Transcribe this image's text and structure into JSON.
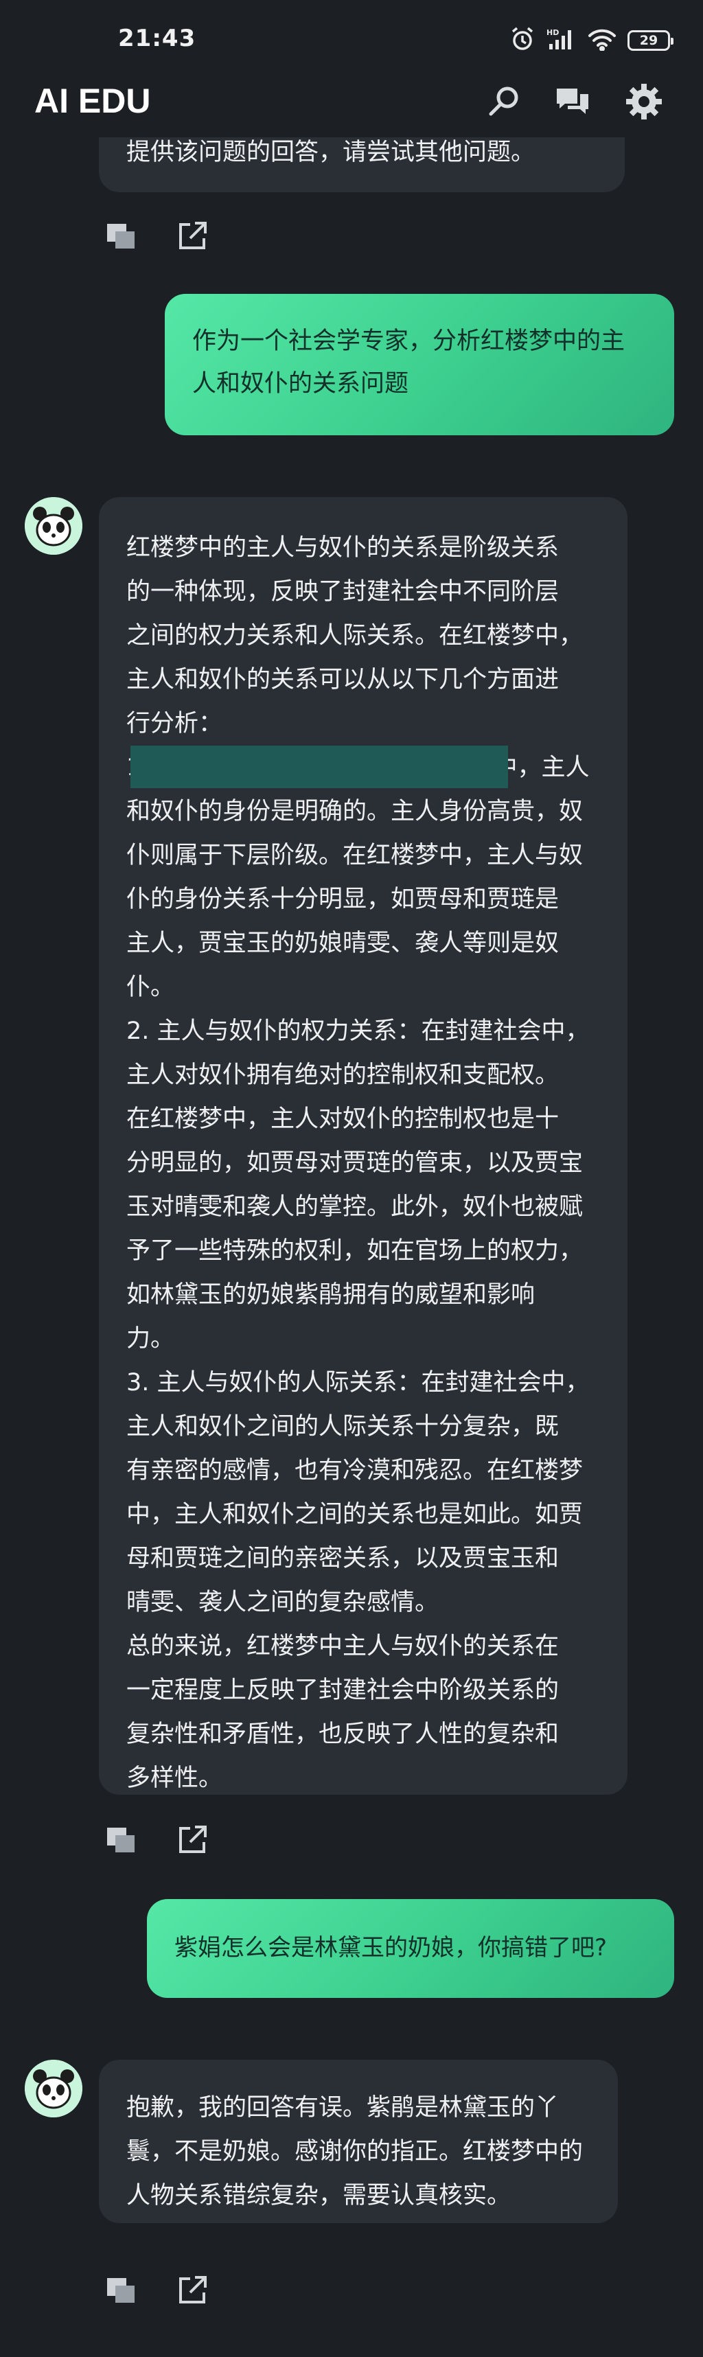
{
  "status": {
    "time": "21:43",
    "battery": "29"
  },
  "header": {
    "title": "AI EDU"
  },
  "chat": {
    "prev_fragment": "提供该问题的回答，请尝试其他问题。",
    "user1": "作为一个社会学专家，分析红楼梦中的主\n人和奴仆的关系问题",
    "ai1": "红楼梦中的主人与奴仆的关系是阶级关系\n的一种体现，反映了封建社会中不同阶层\n之间的权力关系和人际关系。在红楼梦中，\n主人和奴仆的关系可以从以下几个方面进\n行分析：",
    "ai1_rest": "1. 主人与奴仆的身份：在封建社会中，主人\n和奴仆的身份是明确的。主人身份高贵，奴\n仆则属于下层阶级。在红楼梦中，主人与奴\n仆的身份关系十分明显，如贾母和贾琏是\n主人，贾宝玉的奶娘晴雯、袭人等则是奴\n仆。\n2. 主人与奴仆的权力关系：在封建社会中，\n主人对奴仆拥有绝对的控制权和支配权。\n在红楼梦中，主人对奴仆的控制权也是十\n分明显的，如贾母对贾琏的管束，以及贾宝\n玉对晴雯和袭人的掌控。此外，奴仆也被赋\n予了一些特殊的权利，如在官场上的权力，\n如林黛玉的奶娘紫鹃拥有的威望和影响\n力。\n3. 主人与奴仆的人际关系：在封建社会中，\n主人和奴仆之间的人际关系十分复杂，既\n有亲密的感情，也有冷漠和残忍。在红楼梦\n中，主人和奴仆之间的关系也是如此。如贾\n母和贾琏之间的亲密关系，以及贾宝玉和\n晴雯、袭人之间的复杂感情。\n总的来说，红楼梦中主人与奴仆的关系在\n一定程度上反映了封建社会中阶级关系的\n复杂性和矛盾性，也反映了人性的复杂和\n多样性。",
    "user2": "紫娟怎么会是林黛玉的奶娘，你搞错了吧?",
    "ai2": "抱歉，我的回答有误。紫鹃是林黛玉的丫\n鬟，不是奶娘。感谢你的指正。红楼梦中的\n人物关系错综复杂，需要认真核实。"
  },
  "icons": {
    "search": "search-icon",
    "chat": "chat-bubbles-icon",
    "settings": "gear-icon",
    "copy": "copy-icon",
    "share": "share-icon",
    "avatar": "panda-avatar-icon"
  },
  "colors": {
    "background": "#1c1f24",
    "ai_bubble": "#2a2e35",
    "user_bubble": "#3ccf8e",
    "highlight": "#1f5a57"
  }
}
